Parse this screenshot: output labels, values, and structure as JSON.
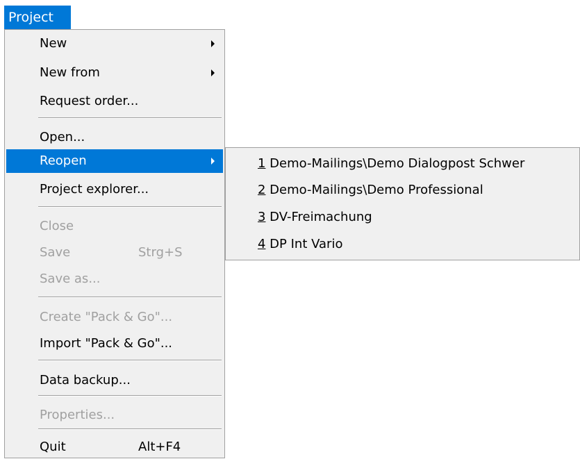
{
  "menubar": {
    "project_label": "Project"
  },
  "menu": {
    "items": [
      {
        "label": "New",
        "has_submenu": true
      },
      {
        "label": "New from",
        "has_submenu": true
      },
      {
        "label": "Request order..."
      },
      {
        "label": "Open..."
      },
      {
        "label": "Reopen",
        "has_submenu": true,
        "highlighted": true
      },
      {
        "label": "Project explorer..."
      },
      {
        "label": "Close",
        "disabled": true
      },
      {
        "label": "Save",
        "shortcut": "Strg+S",
        "disabled": true
      },
      {
        "label": "Save as...",
        "disabled": true
      },
      {
        "label": "Create \"Pack & Go\"...",
        "disabled": true
      },
      {
        "label": "Import \"Pack & Go\"..."
      },
      {
        "label": "Data backup..."
      },
      {
        "label": "Properties...",
        "disabled": true
      },
      {
        "label": "Quit",
        "shortcut": "Alt+F4"
      }
    ]
  },
  "reopen_submenu": {
    "items": [
      {
        "num": "1",
        "text": " Demo-Mailings\\Demo Dialogpost Schwer"
      },
      {
        "num": "2",
        "text": " Demo-Mailings\\Demo Professional"
      },
      {
        "num": "3",
        "text": " DV-Freimachung"
      },
      {
        "num": "4",
        "text": " DP Int Vario"
      }
    ]
  },
  "colors": {
    "highlight": "#0078d7",
    "menu_bg": "#f0f0f0",
    "disabled_text": "#a0a0a0"
  },
  "icons": {
    "submenu_arrow": "chevron-right-icon"
  }
}
